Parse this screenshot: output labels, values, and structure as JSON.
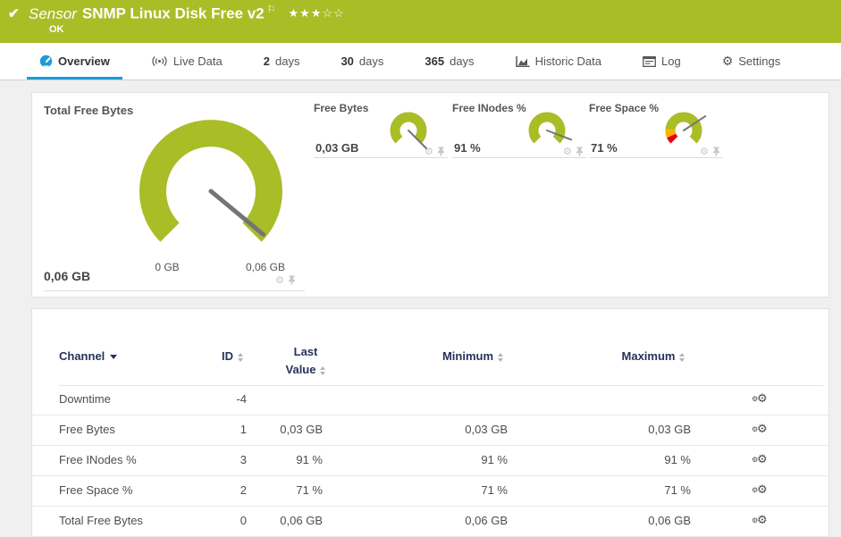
{
  "colors": {
    "brand_green": "#a9bd27",
    "accent_blue": "#1d9bd7",
    "gauge_green": "#a9bd27",
    "gauge_red": "#e2001a",
    "gauge_yellow": "#f9b200",
    "needle_gray": "#757575",
    "header_navy": "#26335b"
  },
  "sensor_header": {
    "check_icon": "✔",
    "kind": "Sensor",
    "name": "SNMP Linux Disk Free v2",
    "flag_icon": "⚐",
    "stars": "★★★☆☆",
    "status": "OK"
  },
  "tabs": [
    {
      "label": "Overview",
      "icon": "gauge",
      "active": true
    },
    {
      "label": "Live Data",
      "icon": "broadcast"
    },
    {
      "num": "2",
      "label": "days"
    },
    {
      "num": "30",
      "label": "days"
    },
    {
      "num": "365",
      "label": "days"
    },
    {
      "label": "Historic Data",
      "icon": "chart"
    },
    {
      "label": "Log",
      "icon": "log"
    },
    {
      "label": "Settings",
      "icon": "gear"
    }
  ],
  "gauges": {
    "main": {
      "title": "Total Free Bytes",
      "value": "0,06 GB",
      "scale_min": "0 GB",
      "scale_max": "0,06 GB",
      "percent": 98
    },
    "minis": [
      {
        "title": "Free Bytes",
        "value": "0,03 GB",
        "percent": 100,
        "segments": []
      },
      {
        "title": "Free INodes %",
        "value": "91 %",
        "percent": 91,
        "segments": []
      },
      {
        "title": "Free Space %",
        "value": "71 %",
        "percent": 71,
        "segments": [
          {
            "color": "#f9b200",
            "to": 19
          },
          {
            "color": "#e2001a",
            "to": 8
          }
        ]
      }
    ]
  },
  "table": {
    "columns": [
      "Channel",
      "ID",
      "Last Value",
      "Minimum",
      "Maximum"
    ],
    "rows": [
      {
        "channel": "Downtime",
        "id": "-4",
        "last": "",
        "min": "",
        "max": ""
      },
      {
        "channel": "Free Bytes",
        "id": "1",
        "last": "0,03 GB",
        "min": "0,03 GB",
        "max": "0,03 GB"
      },
      {
        "channel": "Free INodes %",
        "id": "3",
        "last": "91 %",
        "min": "91 %",
        "max": "91 %"
      },
      {
        "channel": "Free Space %",
        "id": "2",
        "last": "71 %",
        "min": "71 %",
        "max": "71 %"
      },
      {
        "channel": "Total Free Bytes",
        "id": "0",
        "last": "0,06 GB",
        "min": "0,06 GB",
        "max": "0,06 GB"
      }
    ]
  }
}
